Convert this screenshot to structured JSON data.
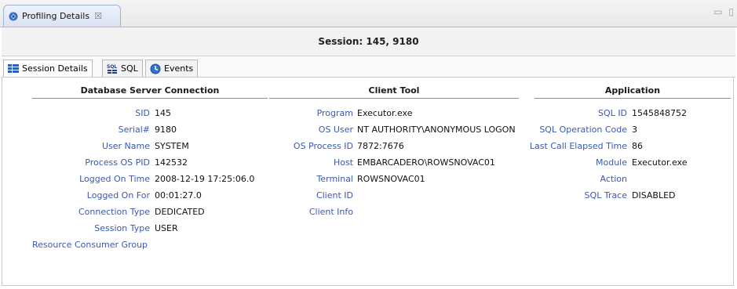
{
  "view_tab": {
    "title": "Profiling Details",
    "close_symbol": "☒"
  },
  "session_header": "Session: 145, 9180",
  "tabs": [
    {
      "label": "Session Details",
      "icon": "table-icon"
    },
    {
      "label": "SQL",
      "icon": "sql-icon"
    },
    {
      "label": "Events",
      "icon": "events-icon"
    }
  ],
  "sections": {
    "database": {
      "title": "Database Server Connection",
      "fields": [
        {
          "label": "SID",
          "value": "145"
        },
        {
          "label": "Serial#",
          "value": "9180"
        },
        {
          "label": "User Name",
          "value": "SYSTEM"
        },
        {
          "label": "Process OS PID",
          "value": "142532"
        },
        {
          "label": "Logged On Time",
          "value": "2008-12-19 17:25:06.0"
        },
        {
          "label": "Logged On For",
          "value": "00:01:27.0"
        },
        {
          "label": "Connection Type",
          "value": "DEDICATED"
        },
        {
          "label": "Session Type",
          "value": "USER"
        },
        {
          "label": "Resource Consumer Group",
          "value": ""
        }
      ]
    },
    "client": {
      "title": "Client Tool",
      "fields": [
        {
          "label": "Program",
          "value": "Executor.exe"
        },
        {
          "label": "OS User",
          "value": "NT AUTHORITY\\ANONYMOUS LOGON"
        },
        {
          "label": "OS Process ID",
          "value": "7872:7676"
        },
        {
          "label": "Host",
          "value": "EMBARCADERO\\ROWSNOVAC01"
        },
        {
          "label": "Terminal",
          "value": "ROWSNOVAC01"
        },
        {
          "label": "Client ID",
          "value": ""
        },
        {
          "label": "Client Info",
          "value": ""
        }
      ]
    },
    "application": {
      "title": "Application",
      "fields": [
        {
          "label": "SQL ID",
          "value": "1545848752"
        },
        {
          "label": "SQL Operation Code",
          "value": "3"
        },
        {
          "label": "Last Call Elapsed Time",
          "value": "86"
        },
        {
          "label": "Module",
          "value": "Executor.exe"
        },
        {
          "label": "Action",
          "value": ""
        },
        {
          "label": "SQL Trace",
          "value": "DISABLED"
        }
      ]
    }
  },
  "colors": {
    "label": "#3b59b4",
    "tab_border": "#9fb3d6"
  }
}
